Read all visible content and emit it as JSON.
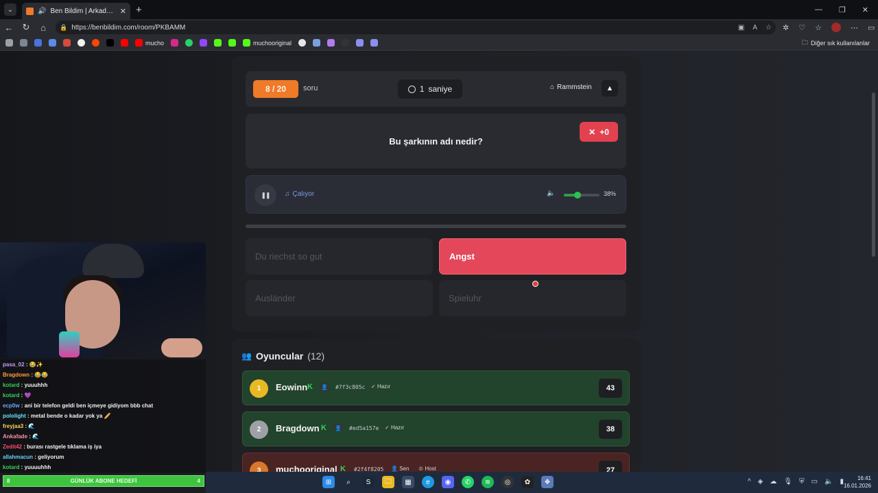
{
  "browser": {
    "tab_title": "Ben Bildim | Arkadaşlarınla Oy",
    "url": "https://benbildim.com/room/PKBAMM",
    "bookmarks": [
      "mucho",
      "muchooriginal"
    ],
    "bookmarks_other": "Diğer sık kullanılanlar"
  },
  "game": {
    "counter": "8 / 20",
    "counter_suffix": "soru",
    "timer_value": "1",
    "timer_unit": "saniye",
    "tag": "Rammstein",
    "question": "Bu şarkının adı nedir?",
    "score_badge": "+0",
    "player_status": "Çalıyor",
    "volume_percent": 38,
    "volume_label": "38%",
    "progress_fraction": 0.0,
    "answers": [
      {
        "label": "Du riechst so gut",
        "selected": false
      },
      {
        "label": "Angst",
        "selected": true
      },
      {
        "label": "Ausländer",
        "selected": false
      },
      {
        "label": "Spieluhr",
        "selected": false
      }
    ]
  },
  "players": {
    "title": "Oyuncular",
    "count": "(12)",
    "list": [
      {
        "rank": "1",
        "name": "Eowinn",
        "id": "#7f3c805c",
        "status": "Hazır",
        "score": "43",
        "rank_color": "#e8b923",
        "tone": "green"
      },
      {
        "rank": "2",
        "name": "Bragdown",
        "id": "#ed5a157e",
        "status": "Hazır",
        "score": "38",
        "rank_color": "#9da1a6",
        "tone": "green"
      },
      {
        "rank": "3",
        "name": "muchooriginal",
        "id": "#2f4f8205",
        "status": "Sen",
        "status2": "Host",
        "score": "27",
        "rank_color": "#d9782a",
        "tone": "red"
      }
    ]
  },
  "chat": {
    "lines": [
      {
        "user": "pasa_02",
        "color": "#c79bff",
        "text": " : 😂✨"
      },
      {
        "user": "Bragdown",
        "color": "#ff9c3a",
        "text": " : 😂😂"
      },
      {
        "user": "kotard",
        "color": "#3ad05a",
        "text": " : yuuuhhh"
      },
      {
        "user": "kotard",
        "color": "#3ad05a",
        "text": " : 💜"
      },
      {
        "user": "ecp0w",
        "color": "#6aa8ff",
        "text": " : ani bir telefon geldi ben içmeye gidiyom bbb chat"
      },
      {
        "user": "pololight",
        "color": "#6ae0ff",
        "text": " : metal bende o kadar yok ya 🥖"
      },
      {
        "user": "freyjaa3",
        "color": "#ffd25a",
        "text": " : 🌊"
      },
      {
        "user": "Ankafade",
        "color": "#ff8fa8",
        "text": " : 🌊"
      },
      {
        "user": "Zedit42",
        "color": "#ff4a6a",
        "text": " : burası rastgele tıklama iş iya"
      },
      {
        "user": "allahmacun",
        "color": "#69d0ff",
        "text": " : geliyorum"
      },
      {
        "user": "kotard",
        "color": "#3ad05a",
        "text": " : yuuuuhhh"
      }
    ],
    "goal_left": "8",
    "goal_text": "GÜNLÜK ABONE HEDEFİ",
    "goal_right": "4"
  },
  "taskbar": {
    "time": "16:41",
    "date": "16.01.2026"
  },
  "colors": {
    "accent_orange": "#ef7a28",
    "selected_red": "#e5475a",
    "player_green": "#22432c"
  }
}
